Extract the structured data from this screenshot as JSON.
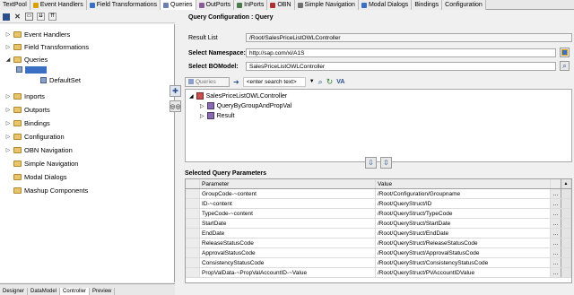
{
  "tabs": [
    {
      "label": "TextPool",
      "icon": "",
      "color": ""
    },
    {
      "label": "Event Handlers",
      "icon": "lightning-icon",
      "color": "#d8a000"
    },
    {
      "label": "Field Transformations",
      "icon": "transform-icon",
      "color": "#3a6fc4"
    },
    {
      "label": "Queries",
      "icon": "query-icon",
      "color": "#6b7fb0"
    },
    {
      "label": "OutPorts",
      "icon": "outport-icon",
      "color": "#8a5a9a"
    },
    {
      "label": "InPorts",
      "icon": "inport-icon",
      "color": "#4a7a4a"
    },
    {
      "label": "OBN",
      "icon": "obn-icon",
      "color": "#b03030"
    },
    {
      "label": "Simple Navigation",
      "icon": "navigation-icon",
      "color": "#707070"
    },
    {
      "label": "Modal Dialogs",
      "icon": "dialog-icon",
      "color": "#3a6fc4"
    },
    {
      "label": "Bindings",
      "icon": "",
      "color": ""
    },
    {
      "label": "Configuration",
      "icon": "",
      "color": ""
    }
  ],
  "tree": {
    "items": [
      {
        "label": "Event Handlers"
      },
      {
        "label": "Field Transformations"
      },
      {
        "label": "Queries"
      },
      {
        "label": "DefaultSet"
      },
      {
        "label": "Inports"
      },
      {
        "label": "Outports"
      },
      {
        "label": "Bindings"
      },
      {
        "label": "Configuration"
      },
      {
        "label": "OBN Navigation"
      },
      {
        "label": "Simple Navigation"
      },
      {
        "label": "Modal Dialogs"
      },
      {
        "label": "Mashup Components"
      }
    ]
  },
  "bottom_tabs": [
    "Designer",
    "DataModel",
    "Controller",
    "Preview"
  ],
  "config": {
    "title": "Query Configuration : Query",
    "result_list_label": "Result List",
    "result_list_value": "/Root/SalesPriceListOWLController",
    "namespace_label": "Select Namespace:",
    "namespace_value": "http://sap.com/xi/A1S",
    "bomodel_label": "Select BOModel:",
    "bomodel_value": "SalesPriceListOWLController"
  },
  "queries": {
    "dropdown": "Queries",
    "search_placeholder": "<enter search text>",
    "va_label": "VA",
    "nodes": [
      {
        "label": "SalesPriceListOWLController"
      },
      {
        "label": "QueryByGroupAndPropVal"
      },
      {
        "label": "Result"
      }
    ]
  },
  "params": {
    "title": "Selected Query Parameters",
    "columns": [
      "Parameter",
      "Value"
    ],
    "rows": [
      {
        "parameter": "GroupCode-~content",
        "value": "/Root/Configuration/Groupname"
      },
      {
        "parameter": "ID-~content",
        "value": "/Root/QueryStruct/ID"
      },
      {
        "parameter": "TypeCode-~content",
        "value": "/Root/QueryStruct/TypeCode"
      },
      {
        "parameter": "StartDate",
        "value": "/Root/QueryStruct/StartDate"
      },
      {
        "parameter": "EndDate",
        "value": "/Root/QueryStruct/EndDate"
      },
      {
        "parameter": "ReleaseStatusCode",
        "value": "/Root/QueryStruct/ReleaseStatusCode"
      },
      {
        "parameter": "ApprovalStatusCode",
        "value": "/Root/QueryStruct/ApprovalStatusCode"
      },
      {
        "parameter": "ConsistencyStatusCode",
        "value": "/Root/QueryStruct/ConsistencyStatusCode"
      },
      {
        "parameter": "PropValData-~PropValAccountID-~Value",
        "value": "/Root/QueryStruct/PVAccountIDValue"
      }
    ],
    "row_button": "..."
  }
}
